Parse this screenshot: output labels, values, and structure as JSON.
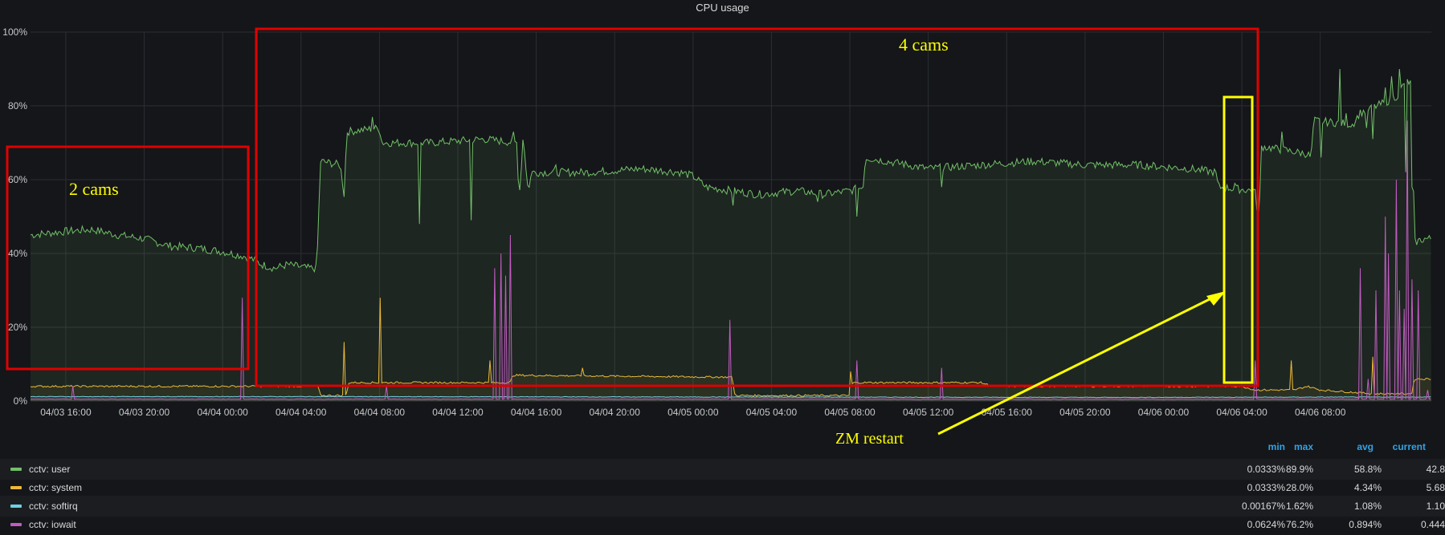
{
  "chart_data": {
    "type": "area",
    "title": "CPU usage",
    "x_ticks": [
      "04/03 16:00",
      "04/03 20:00",
      "04/04 00:00",
      "04/04 04:00",
      "04/04 08:00",
      "04/04 12:00",
      "04/04 16:00",
      "04/04 20:00",
      "04/05 00:00",
      "04/05 04:00",
      "04/05 08:00",
      "04/05 12:00",
      "04/05 16:00",
      "04/05 20:00",
      "04/06 00:00",
      "04/06 04:00",
      "04/06 08:00"
    ],
    "y_ticks": [
      "0%",
      "20%",
      "40%",
      "60%",
      "80%",
      "100%"
    ],
    "ylim": [
      0,
      100
    ],
    "grid": true,
    "legend_placement": "bottom",
    "x_hours_range": [
      -2.7,
      104.5
    ],
    "series": [
      {
        "name": "cctv: user",
        "color": "#73bf69",
        "points": [
          [
            -2.7,
            45
          ],
          [
            0,
            46
          ],
          [
            2,
            46.5
          ],
          [
            4,
            45
          ],
          [
            6,
            44
          ],
          [
            8,
            42
          ],
          [
            10,
            41.5
          ],
          [
            12,
            40.5
          ],
          [
            14,
            39
          ],
          [
            15,
            37
          ],
          [
            16,
            36
          ],
          [
            17,
            37
          ],
          [
            18.5,
            36
          ],
          [
            19.2,
            36
          ],
          [
            19.5,
            65
          ],
          [
            21,
            64
          ],
          [
            21.3,
            56
          ],
          [
            21.5,
            73
          ],
          [
            24,
            74
          ],
          [
            24.2,
            70
          ],
          [
            28,
            70
          ],
          [
            32,
            71
          ],
          [
            34.5,
            70
          ],
          [
            34.7,
            55
          ],
          [
            35,
            72
          ],
          [
            35.4,
            56
          ],
          [
            35.6,
            62
          ],
          [
            40,
            62
          ],
          [
            44,
            63
          ],
          [
            47,
            62
          ],
          [
            48,
            61
          ],
          [
            49,
            58
          ],
          [
            53,
            56
          ],
          [
            56,
            57
          ],
          [
            58,
            56
          ],
          [
            60,
            57
          ],
          [
            61,
            58
          ],
          [
            61.2,
            66
          ],
          [
            66,
            63
          ],
          [
            70,
            64
          ],
          [
            74,
            65
          ],
          [
            78,
            64
          ],
          [
            82,
            64
          ],
          [
            86,
            63
          ],
          [
            88,
            62
          ],
          [
            88.2,
            58
          ],
          [
            91,
            57
          ],
          [
            91.3,
            48
          ],
          [
            91.5,
            69
          ],
          [
            95,
            67
          ],
          [
            95.3,
            66
          ],
          [
            95.5,
            76
          ],
          [
            98.5,
            75
          ],
          [
            99,
            78
          ],
          [
            101,
            81
          ],
          [
            102,
            83
          ],
          [
            102.5,
            87
          ],
          [
            103,
            86
          ],
          [
            103.2,
            43
          ],
          [
            104,
            44
          ],
          [
            104.5,
            44
          ]
        ],
        "spikes": [
          [
            23.5,
            77
          ],
          [
            27,
            48
          ],
          [
            31,
            49
          ],
          [
            34.3,
            73
          ],
          [
            37.5,
            64
          ],
          [
            51,
            53
          ],
          [
            57.5,
            54
          ],
          [
            60.5,
            50
          ],
          [
            64,
            65
          ],
          [
            67,
            58
          ],
          [
            89.5,
            59
          ],
          [
            93,
            73
          ],
          [
            96,
            66
          ],
          [
            97.5,
            90
          ],
          [
            98,
            78
          ],
          [
            99.5,
            74
          ],
          [
            100,
            71
          ],
          [
            101,
            85
          ],
          [
            101.5,
            88
          ],
          [
            102,
            90
          ],
          [
            102.5,
            62
          ],
          [
            103,
            58
          ]
        ],
        "min": "0.0333%",
        "max": "89.9%",
        "avg": "58.8%",
        "current": "42.8"
      },
      {
        "name": "cctv: system",
        "color": "#eab839",
        "points": [
          [
            -2.7,
            4
          ],
          [
            10,
            4
          ],
          [
            19.3,
            4
          ],
          [
            19.5,
            1.5
          ],
          [
            21.5,
            1.5
          ],
          [
            21.6,
            5
          ],
          [
            34,
            5
          ],
          [
            34.2,
            7
          ],
          [
            50,
            6.5
          ],
          [
            51,
            6.5
          ],
          [
            51.2,
            1.5
          ],
          [
            60,
            1.5
          ],
          [
            60.2,
            5
          ],
          [
            70,
            5
          ],
          [
            71,
            4
          ],
          [
            80,
            4
          ],
          [
            90,
            4
          ],
          [
            91,
            3
          ],
          [
            94,
            3
          ],
          [
            95,
            4
          ],
          [
            96,
            3
          ],
          [
            100,
            2
          ],
          [
            102,
            2
          ],
          [
            103,
            2
          ],
          [
            103.2,
            6
          ],
          [
            104.5,
            6
          ]
        ],
        "spikes": [
          [
            21.3,
            16
          ],
          [
            24,
            28
          ],
          [
            32.5,
            11
          ],
          [
            39.5,
            9
          ],
          [
            60,
            8
          ],
          [
            93.8,
            11
          ],
          [
            100,
            12
          ]
        ],
        "min": "0.0333%",
        "max": "28.0%",
        "avg": "4.34%",
        "current": "5.68"
      },
      {
        "name": "cctv: softirq",
        "color": "#6ed0e0",
        "points": [
          [
            -2.7,
            1.2
          ],
          [
            20,
            1.2
          ],
          [
            50,
            1.1
          ],
          [
            80,
            1.0
          ],
          [
            104.5,
            1.1
          ]
        ],
        "spikes": [],
        "min": "0.00167%",
        "max": "1.62%",
        "avg": "1.08%",
        "current": "1.10"
      },
      {
        "name": "cctv: iowait",
        "color": "#c15cc1",
        "points": [
          [
            -2.7,
            0.5
          ],
          [
            104.5,
            0.5
          ]
        ],
        "spikes": [
          [
            0.5,
            4
          ],
          [
            13.5,
            28
          ],
          [
            24.5,
            4
          ],
          [
            32.8,
            36
          ],
          [
            33.3,
            40
          ],
          [
            33.6,
            34
          ],
          [
            34,
            45
          ],
          [
            50.8,
            22
          ],
          [
            60.5,
            11
          ],
          [
            67,
            9
          ],
          [
            91,
            11
          ],
          [
            99,
            36
          ],
          [
            99.6,
            6
          ],
          [
            100.2,
            30
          ],
          [
            101,
            50
          ],
          [
            101.2,
            40
          ],
          [
            101.8,
            60
          ],
          [
            102,
            30
          ],
          [
            102.4,
            25
          ],
          [
            102.7,
            76
          ],
          [
            103,
            33
          ],
          [
            103.5,
            30
          ],
          [
            104.2,
            3
          ]
        ],
        "min": "0.0624%",
        "max": "76.2%",
        "avg": "0.894%",
        "current": "0.444"
      }
    ]
  },
  "annotations": {
    "left_box_label": "2 cams",
    "right_box_label": "4 cams",
    "arrow_label": "ZM restart",
    "red": "#e00000",
    "yellow": "#ffff00"
  },
  "legend": {
    "headers": {
      "min": "min",
      "max": "max",
      "avg": "avg",
      "current": "current"
    }
  }
}
